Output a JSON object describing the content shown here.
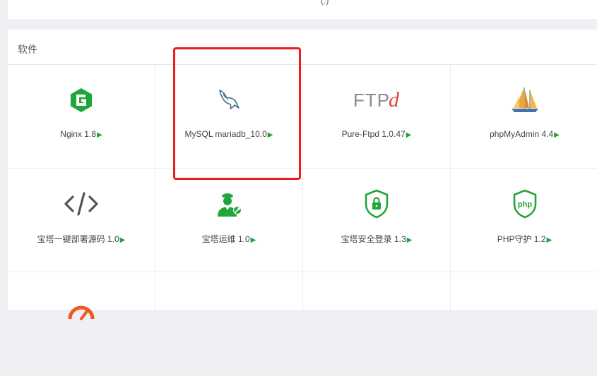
{
  "top_fragment": "(.)",
  "panel": {
    "title": "软件"
  },
  "arrow": "▶",
  "items": [
    {
      "label": "Nginx 1.8",
      "icon": "nginx-icon"
    },
    {
      "label": "MySQL mariadb_10.0",
      "icon": "mysql-dolphin-icon"
    },
    {
      "label": "Pure-Ftpd 1.0.47",
      "icon": "ftp-icon",
      "logo_text": "FTP",
      "logo_accent": "d"
    },
    {
      "label": "phpMyAdmin 4.4",
      "icon": "sailboat-icon"
    },
    {
      "label": "宝塔一键部署源码 1.0",
      "icon": "code-brackets-icon"
    },
    {
      "label": "宝塔运维 1.0",
      "icon": "maintenance-worker-icon"
    },
    {
      "label": "宝塔安全登录 1.3",
      "icon": "secure-login-shield-icon"
    },
    {
      "label": "PHP守护 1.2",
      "icon": "php-shield-icon",
      "badge_text": "php"
    }
  ],
  "colors": {
    "green": "#20a53a",
    "highlight": "#ee1b1b",
    "mysql_blue": "#3e6e8c",
    "ftp_red": "#d8473c"
  }
}
